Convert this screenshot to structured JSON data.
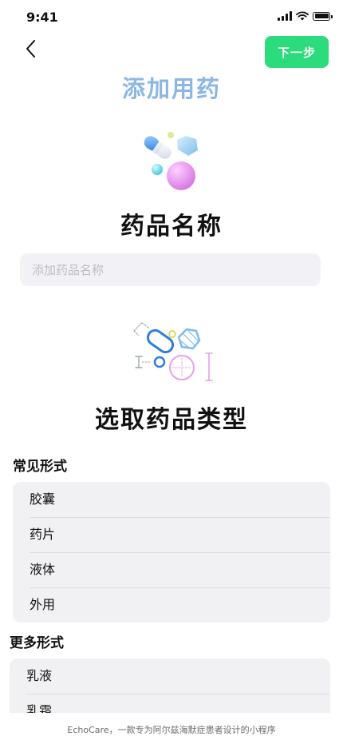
{
  "status_bar": {
    "time": "9:41"
  },
  "header": {
    "back_icon": "chevron-left-icon",
    "next_label": "下一步",
    "title": "添加用药"
  },
  "medicine_name": {
    "heading": "药品名称",
    "placeholder": "添加药品名称"
  },
  "medicine_type": {
    "heading": "选取药品类型"
  },
  "common_forms": {
    "label": "常见形式",
    "items": [
      "胶囊",
      "药片",
      "液体",
      "外用"
    ]
  },
  "more_forms": {
    "label": "更多形式",
    "items": [
      "乳液",
      "乳霜"
    ]
  },
  "footer": {
    "text": "EchoCare，一款专为阿尔兹海默症患者设计的小程序"
  },
  "colors": {
    "accent": "#2bdc7c",
    "title": "#8cb6e3",
    "card_bg": "#f1f1f4"
  }
}
